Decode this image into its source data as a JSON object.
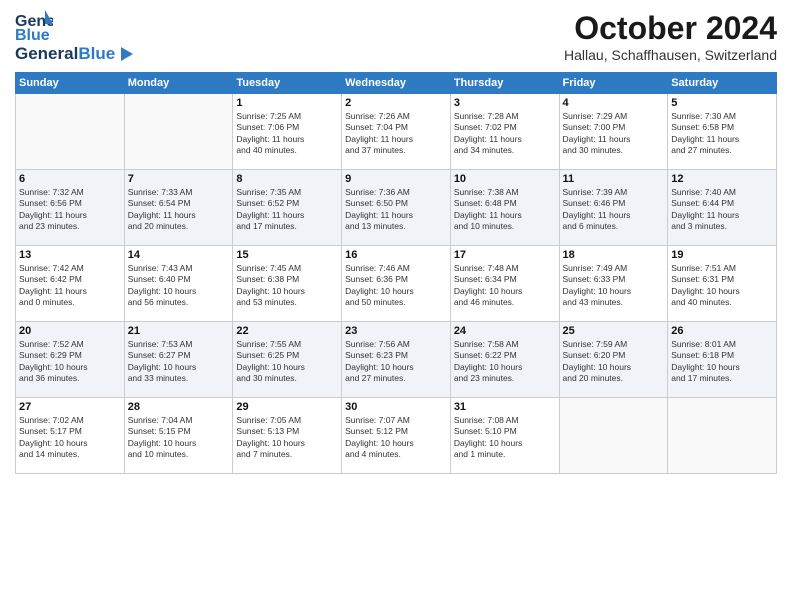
{
  "header": {
    "logo_general": "General",
    "logo_blue": "Blue",
    "month_title": "October 2024",
    "location": "Hallau, Schaffhausen, Switzerland"
  },
  "days_of_week": [
    "Sunday",
    "Monday",
    "Tuesday",
    "Wednesday",
    "Thursday",
    "Friday",
    "Saturday"
  ],
  "weeks": [
    [
      {
        "day": "",
        "info": ""
      },
      {
        "day": "",
        "info": ""
      },
      {
        "day": "1",
        "info": "Sunrise: 7:25 AM\nSunset: 7:06 PM\nDaylight: 11 hours\nand 40 minutes."
      },
      {
        "day": "2",
        "info": "Sunrise: 7:26 AM\nSunset: 7:04 PM\nDaylight: 11 hours\nand 37 minutes."
      },
      {
        "day": "3",
        "info": "Sunrise: 7:28 AM\nSunset: 7:02 PM\nDaylight: 11 hours\nand 34 minutes."
      },
      {
        "day": "4",
        "info": "Sunrise: 7:29 AM\nSunset: 7:00 PM\nDaylight: 11 hours\nand 30 minutes."
      },
      {
        "day": "5",
        "info": "Sunrise: 7:30 AM\nSunset: 6:58 PM\nDaylight: 11 hours\nand 27 minutes."
      }
    ],
    [
      {
        "day": "6",
        "info": "Sunrise: 7:32 AM\nSunset: 6:56 PM\nDaylight: 11 hours\nand 23 minutes."
      },
      {
        "day": "7",
        "info": "Sunrise: 7:33 AM\nSunset: 6:54 PM\nDaylight: 11 hours\nand 20 minutes."
      },
      {
        "day": "8",
        "info": "Sunrise: 7:35 AM\nSunset: 6:52 PM\nDaylight: 11 hours\nand 17 minutes."
      },
      {
        "day": "9",
        "info": "Sunrise: 7:36 AM\nSunset: 6:50 PM\nDaylight: 11 hours\nand 13 minutes."
      },
      {
        "day": "10",
        "info": "Sunrise: 7:38 AM\nSunset: 6:48 PM\nDaylight: 11 hours\nand 10 minutes."
      },
      {
        "day": "11",
        "info": "Sunrise: 7:39 AM\nSunset: 6:46 PM\nDaylight: 11 hours\nand 6 minutes."
      },
      {
        "day": "12",
        "info": "Sunrise: 7:40 AM\nSunset: 6:44 PM\nDaylight: 11 hours\nand 3 minutes."
      }
    ],
    [
      {
        "day": "13",
        "info": "Sunrise: 7:42 AM\nSunset: 6:42 PM\nDaylight: 11 hours\nand 0 minutes."
      },
      {
        "day": "14",
        "info": "Sunrise: 7:43 AM\nSunset: 6:40 PM\nDaylight: 10 hours\nand 56 minutes."
      },
      {
        "day": "15",
        "info": "Sunrise: 7:45 AM\nSunset: 6:38 PM\nDaylight: 10 hours\nand 53 minutes."
      },
      {
        "day": "16",
        "info": "Sunrise: 7:46 AM\nSunset: 6:36 PM\nDaylight: 10 hours\nand 50 minutes."
      },
      {
        "day": "17",
        "info": "Sunrise: 7:48 AM\nSunset: 6:34 PM\nDaylight: 10 hours\nand 46 minutes."
      },
      {
        "day": "18",
        "info": "Sunrise: 7:49 AM\nSunset: 6:33 PM\nDaylight: 10 hours\nand 43 minutes."
      },
      {
        "day": "19",
        "info": "Sunrise: 7:51 AM\nSunset: 6:31 PM\nDaylight: 10 hours\nand 40 minutes."
      }
    ],
    [
      {
        "day": "20",
        "info": "Sunrise: 7:52 AM\nSunset: 6:29 PM\nDaylight: 10 hours\nand 36 minutes."
      },
      {
        "day": "21",
        "info": "Sunrise: 7:53 AM\nSunset: 6:27 PM\nDaylight: 10 hours\nand 33 minutes."
      },
      {
        "day": "22",
        "info": "Sunrise: 7:55 AM\nSunset: 6:25 PM\nDaylight: 10 hours\nand 30 minutes."
      },
      {
        "day": "23",
        "info": "Sunrise: 7:56 AM\nSunset: 6:23 PM\nDaylight: 10 hours\nand 27 minutes."
      },
      {
        "day": "24",
        "info": "Sunrise: 7:58 AM\nSunset: 6:22 PM\nDaylight: 10 hours\nand 23 minutes."
      },
      {
        "day": "25",
        "info": "Sunrise: 7:59 AM\nSunset: 6:20 PM\nDaylight: 10 hours\nand 20 minutes."
      },
      {
        "day": "26",
        "info": "Sunrise: 8:01 AM\nSunset: 6:18 PM\nDaylight: 10 hours\nand 17 minutes."
      }
    ],
    [
      {
        "day": "27",
        "info": "Sunrise: 7:02 AM\nSunset: 5:17 PM\nDaylight: 10 hours\nand 14 minutes."
      },
      {
        "day": "28",
        "info": "Sunrise: 7:04 AM\nSunset: 5:15 PM\nDaylight: 10 hours\nand 10 minutes."
      },
      {
        "day": "29",
        "info": "Sunrise: 7:05 AM\nSunset: 5:13 PM\nDaylight: 10 hours\nand 7 minutes."
      },
      {
        "day": "30",
        "info": "Sunrise: 7:07 AM\nSunset: 5:12 PM\nDaylight: 10 hours\nand 4 minutes."
      },
      {
        "day": "31",
        "info": "Sunrise: 7:08 AM\nSunset: 5:10 PM\nDaylight: 10 hours\nand 1 minute."
      },
      {
        "day": "",
        "info": ""
      },
      {
        "day": "",
        "info": ""
      }
    ]
  ]
}
